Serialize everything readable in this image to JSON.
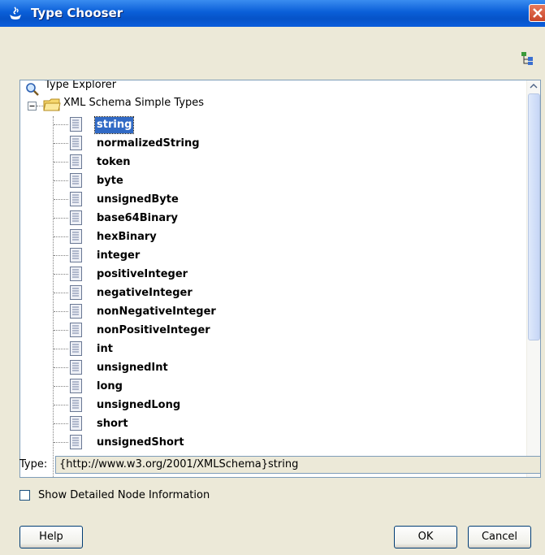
{
  "window": {
    "title": "Type Chooser"
  },
  "tree": {
    "root_label": "Type Explorer",
    "folder_label": "XML Schema Simple Types",
    "selected_index": 0,
    "items": [
      "string",
      "normalizedString",
      "token",
      "byte",
      "unsignedByte",
      "base64Binary",
      "hexBinary",
      "integer",
      "positiveInteger",
      "negativeInteger",
      "nonNegativeInteger",
      "nonPositiveInteger",
      "int",
      "unsignedInt",
      "long",
      "unsignedLong",
      "short",
      "unsignedShort"
    ]
  },
  "type_field": {
    "label": "Type:",
    "value": "{http://www.w3.org/2001/XMLSchema}string"
  },
  "checkbox": {
    "label": "Show Detailed Node Information",
    "checked": false
  },
  "buttons": {
    "help": "Help",
    "ok": "OK",
    "cancel": "Cancel"
  },
  "colors": {
    "titlebar": "#0a5fd8",
    "selection": "#316ac5",
    "dialog_bg": "#ece9d8"
  }
}
